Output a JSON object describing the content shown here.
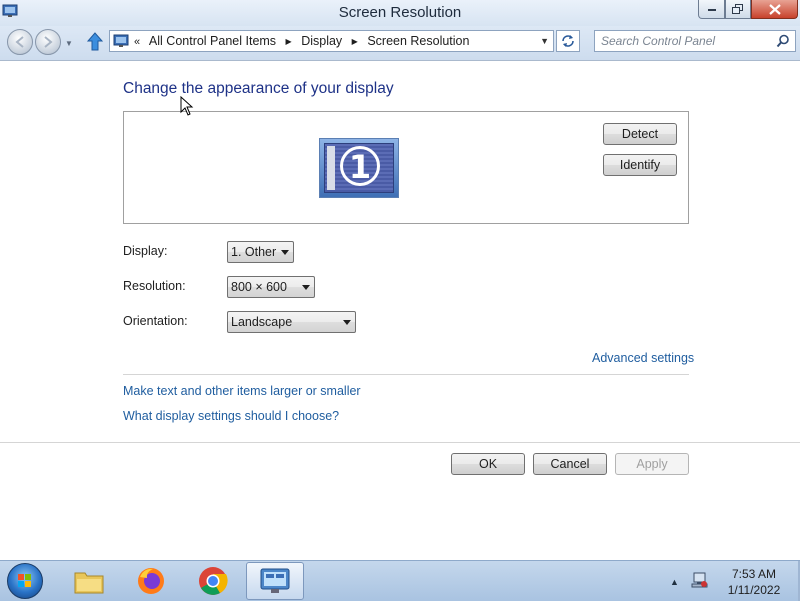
{
  "window": {
    "title": "Screen Resolution"
  },
  "navbar": {
    "breadcrumb": {
      "overflow": "«",
      "items": [
        "All Control Panel Items",
        "Display",
        "Screen Resolution"
      ]
    },
    "search_placeholder": "Search Control Panel"
  },
  "content": {
    "heading": "Change the appearance of your display",
    "monitor_number": "1",
    "detect_label": "Detect",
    "identify_label": "Identify",
    "display_label": "Display:",
    "display_value": "1. Other",
    "resolution_label": "Resolution:",
    "resolution_value": "800 × 600",
    "orientation_label": "Orientation:",
    "orientation_value": "Landscape",
    "advanced_link": "Advanced settings",
    "text_size_link": "Make text and other items larger or smaller",
    "help_link": "What display settings should I choose?",
    "ok_label": "OK",
    "cancel_label": "Cancel",
    "apply_label": "Apply"
  },
  "taskbar": {
    "items": [
      "start-orb",
      "file-explorer-icon",
      "firefox-icon",
      "chrome-icon",
      "control-panel-icon"
    ],
    "clock_time": "7:53 AM",
    "clock_date": "1/11/2022"
  },
  "colors": {
    "heading": "#1e3287",
    "link": "#1f5d9f",
    "titlebar": "#dbe6f3",
    "taskbar": "#b7cde6"
  }
}
